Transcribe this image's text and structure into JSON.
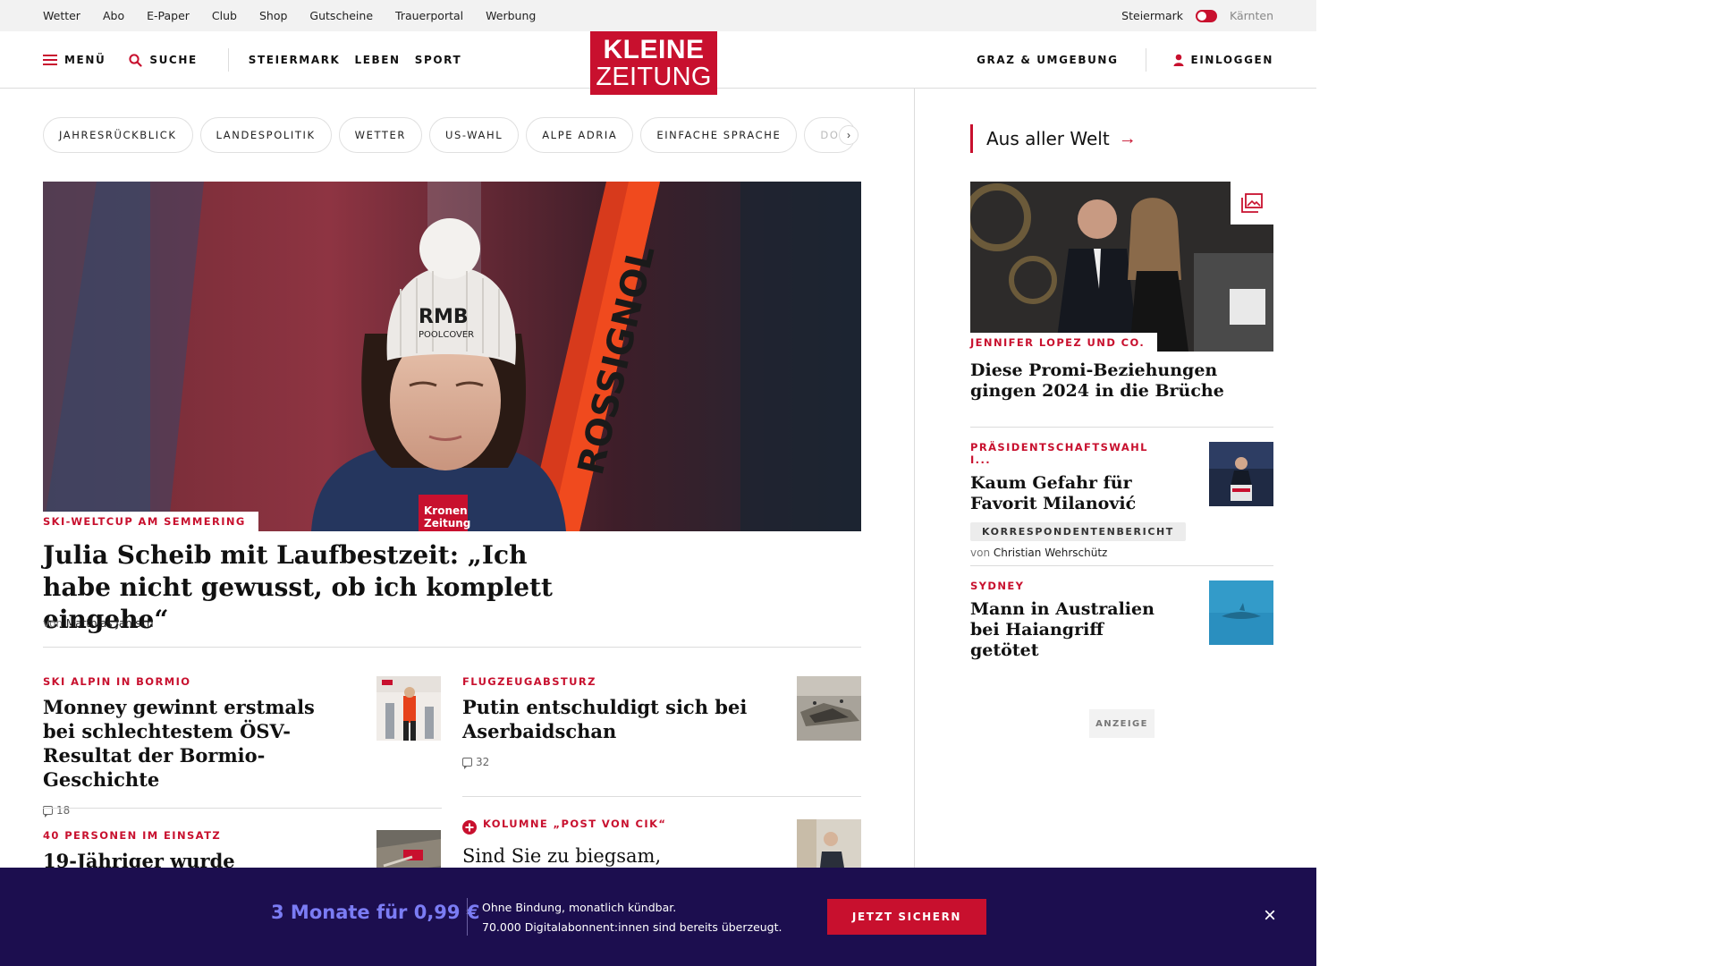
{
  "util_bar": {
    "links": [
      "Wetter",
      "Abo",
      "E-Paper",
      "Club",
      "Shop",
      "Gutscheine",
      "Trauerportal",
      "Werbung"
    ],
    "region_active": "Steiermark",
    "region_inactive": "Kärnten"
  },
  "nav": {
    "menu_label": "MENÜ",
    "search_label": "SUCHE",
    "sections": [
      "STEIERMARK",
      "LEBEN",
      "SPORT"
    ],
    "logo_line1": "KLEINE",
    "logo_line2": "ZEITUNG",
    "local_label": "GRAZ & UMGEBUNG",
    "login_label": "EINLOGGEN"
  },
  "tags": [
    "JAHRESRÜCKBLICK",
    "LANDESPOLITIK",
    "WETTER",
    "US-WAHL",
    "ALPE ADRIA",
    "EINFACHE SPRACHE",
    "DO"
  ],
  "hero": {
    "kicker": "SKI-WELTCUP AM SEMMERING",
    "title": "Julia Scheib mit Laufbestzeit: „Ich habe nicht gewusst, ob ich komplett eingehe“",
    "by_prefix": "von",
    "author": "Matthias Janisch",
    "img_texts": [
      "RMB",
      "POOLCOVER",
      "ROSSIGNOL",
      "Kronen",
      "Zeitung"
    ]
  },
  "articles": [
    {
      "kicker": "SKI ALPIN IN BORMIO",
      "title": "Monney gewinnt erstmals bei schlechtestem ÖSV-Resultat der Bormio-Geschichte",
      "comments": "18"
    },
    {
      "kicker": "FLUGZEUGABSTURZ",
      "title": "Putin entschuldigt sich bei Aserbaidschan",
      "comments": "32"
    },
    {
      "kicker": "40 PERSONEN IM EINSATZ",
      "title": "19-Jähriger wurde"
    },
    {
      "kicker": "KOLUMNE „POST VON CIK“",
      "title": "Sind Sie zu biegsam,"
    }
  ],
  "right": {
    "section_title": "Aus aller Welt",
    "featured": {
      "kicker": "JENNIFER LOPEZ UND CO.",
      "title": "Diese Promi-Beziehungen gingen 2024 in die Brüche"
    },
    "items": [
      {
        "kicker": "PRÄSIDENTSCHAFTSWAHL I...",
        "title": "Kaum Gefahr für Favorit Milanović",
        "badge": "KORRESPONDENTENBERICHT",
        "by_prefix": "von",
        "author": "Christian Wehrschütz"
      },
      {
        "kicker": "SYDNEY",
        "title": "Mann in Australien bei Haiangriff getötet"
      }
    ],
    "ad_label": "ANZEIGE"
  },
  "promo": {
    "price": "3 Monate für 0,99 €",
    "line1": "Ohne Bindung, monatlich kündbar.",
    "line2": "70.000 Digitalabonnent:innen sind bereits überzeugt.",
    "cta": "JETZT SICHERN"
  },
  "colors": {
    "brand_red": "#c8102e",
    "promo_bg": "#1c0e4f",
    "promo_accent": "#7b7cf4"
  }
}
